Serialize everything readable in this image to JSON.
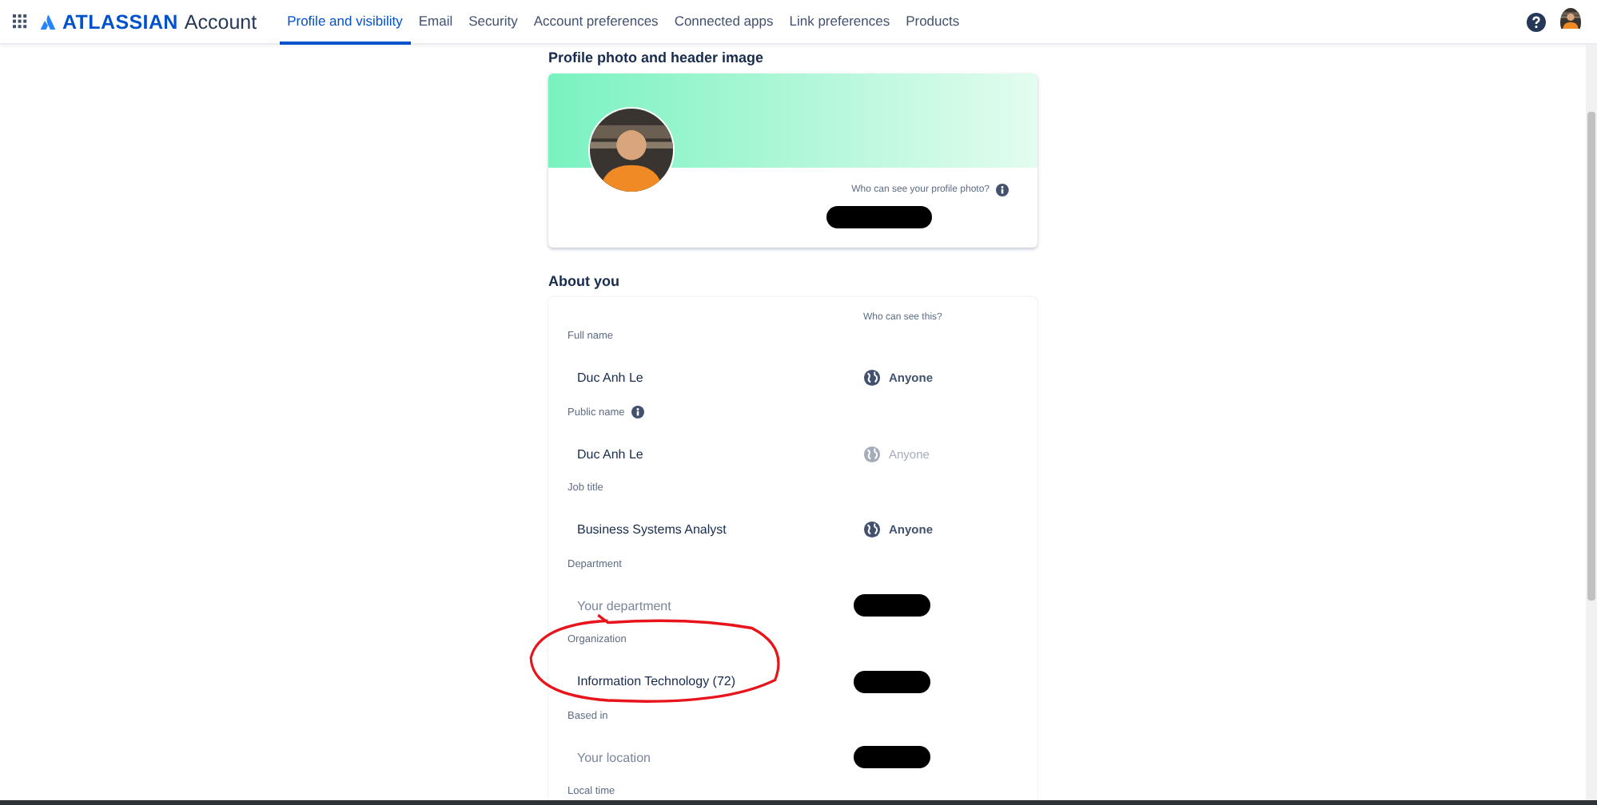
{
  "header": {
    "brand": "ATLASSIAN",
    "product": "Account",
    "tabs": [
      {
        "label": "Profile and visibility",
        "selected": true
      },
      {
        "label": "Email",
        "selected": false
      },
      {
        "label": "Security",
        "selected": false
      },
      {
        "label": "Account preferences",
        "selected": false
      },
      {
        "label": "Connected apps",
        "selected": false
      },
      {
        "label": "Link preferences",
        "selected": false
      },
      {
        "label": "Products",
        "selected": false
      }
    ]
  },
  "photo_section": {
    "title": "Profile photo and header image",
    "visibility_question": "Who can see your profile photo?",
    "visibility": {
      "kind": "redacted"
    }
  },
  "about_section": {
    "title": "About you",
    "column_header": "Who can see this?",
    "fields": [
      {
        "label": "Full name",
        "info": false,
        "value": "Duc Anh Le",
        "visibility": {
          "kind": "audience",
          "text": "Anyone",
          "disabled": false
        }
      },
      {
        "label": "Public name",
        "info": true,
        "value": "Duc Anh Le",
        "visibility": {
          "kind": "audience",
          "text": "Anyone",
          "disabled": true
        }
      },
      {
        "label": "Job title",
        "info": false,
        "value": "Business Systems Analyst",
        "visibility": {
          "kind": "audience",
          "text": "Anyone",
          "disabled": false
        }
      },
      {
        "label": "Department",
        "info": false,
        "placeholder": "Your department",
        "visibility": {
          "kind": "redacted"
        }
      },
      {
        "label": "Organization",
        "info": false,
        "value": "Information Technology (72)",
        "annotated": true,
        "visibility": {
          "kind": "redacted"
        }
      },
      {
        "label": "Based in",
        "info": false,
        "placeholder": "Your location",
        "visibility": {
          "kind": "redacted"
        }
      },
      {
        "label": "Local time",
        "info": false
      }
    ]
  }
}
